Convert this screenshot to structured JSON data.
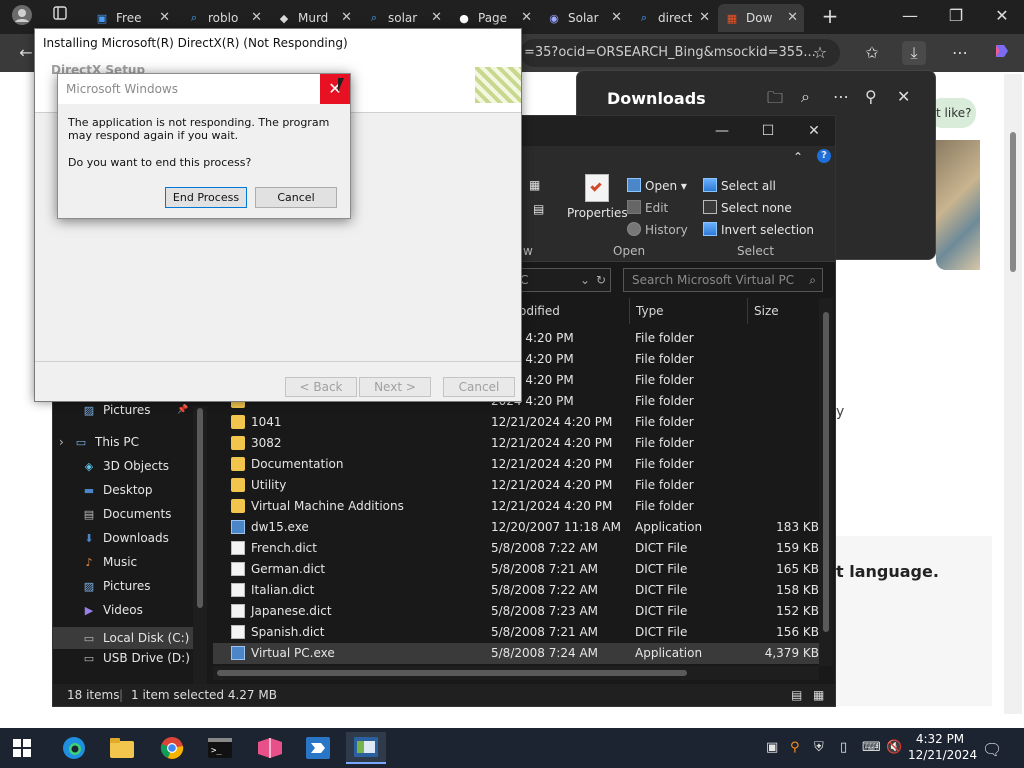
{
  "browser": {
    "tabs": [
      {
        "label": "Free",
        "icon": "edge-page-icon"
      },
      {
        "label": "roblo",
        "icon": "search-icon"
      },
      {
        "label": "Murd",
        "icon": "roblox-icon"
      },
      {
        "label": "solar",
        "icon": "search-icon"
      },
      {
        "label": "Page",
        "icon": "github-icon"
      },
      {
        "label": "Solar",
        "icon": "site-icon"
      },
      {
        "label": "direct",
        "icon": "search-icon"
      },
      {
        "label": "Dow",
        "icon": "microsoft-icon"
      }
    ],
    "address_text": "=35?ocid=ORSEARCH_Bing&msockid=355...",
    "downloads_title": "Downloads"
  },
  "webpage": {
    "bubble_text": "t like?",
    "side_text": "y",
    "language_text": "t language."
  },
  "directx": {
    "title": "Installing Microsoft(R) DirectX(R) (Not Responding)",
    "header": "DirectX Setup",
    "back": "< Back",
    "next": "Next >",
    "cancel": "Cancel"
  },
  "dialog": {
    "title": "Microsoft Windows",
    "message1": "The application is not responding. The program may respond again if you wait.",
    "message2": "Do you want to end this process?",
    "end_process": "End Process",
    "cancel": "Cancel"
  },
  "explorer": {
    "ribbon": {
      "properties": "Properties",
      "open": "Open",
      "edit": "Edit",
      "history": "History",
      "select_all": "Select all",
      "select_none": "Select none",
      "invert_selection": "Invert selection",
      "group_view": "w",
      "group_open": "Open",
      "group_select": "Select"
    },
    "location_fragment": "C",
    "search_placeholder": "Search Microsoft Virtual PC",
    "columns": {
      "modified": "odified",
      "type": "Type",
      "size": "Size"
    },
    "nav": [
      {
        "label": "Pictures",
        "icon": "pictures-icon"
      },
      {
        "label": "This PC",
        "icon": "pc-icon"
      },
      {
        "label": "3D Objects",
        "icon": "3d-objects-icon"
      },
      {
        "label": "Desktop",
        "icon": "desktop-icon"
      },
      {
        "label": "Documents",
        "icon": "documents-icon"
      },
      {
        "label": "Downloads",
        "icon": "downloads-icon"
      },
      {
        "label": "Music",
        "icon": "music-icon"
      },
      {
        "label": "Pictures",
        "icon": "pictures-icon"
      },
      {
        "label": "Videos",
        "icon": "videos-icon"
      },
      {
        "label": "Local Disk (C:)",
        "icon": "drive-icon"
      },
      {
        "label": "USB Drive (D:)",
        "icon": "usb-drive-icon"
      }
    ],
    "files": [
      {
        "name": "",
        "date": "2024 4:20 PM",
        "type": "File folder",
        "size": "",
        "kind": "folder"
      },
      {
        "name": "",
        "date": "2024 4:20 PM",
        "type": "File folder",
        "size": "",
        "kind": "folder"
      },
      {
        "name": "",
        "date": "2024 4:20 PM",
        "type": "File folder",
        "size": "",
        "kind": "folder"
      },
      {
        "name": "",
        "date": "2024 4:20 PM",
        "type": "File folder",
        "size": "",
        "kind": "folder"
      },
      {
        "name": "1041",
        "date": "12/21/2024 4:20 PM",
        "type": "File folder",
        "size": "",
        "kind": "folder"
      },
      {
        "name": "3082",
        "date": "12/21/2024 4:20 PM",
        "type": "File folder",
        "size": "",
        "kind": "folder"
      },
      {
        "name": "Documentation",
        "date": "12/21/2024 4:20 PM",
        "type": "File folder",
        "size": "",
        "kind": "folder"
      },
      {
        "name": "Utility",
        "date": "12/21/2024 4:20 PM",
        "type": "File folder",
        "size": "",
        "kind": "folder"
      },
      {
        "name": "Virtual Machine Additions",
        "date": "12/21/2024 4:20 PM",
        "type": "File folder",
        "size": "",
        "kind": "folder"
      },
      {
        "name": "dw15.exe",
        "date": "12/20/2007 11:18 AM",
        "type": "Application",
        "size": "183 KB",
        "kind": "exe"
      },
      {
        "name": "French.dict",
        "date": "5/8/2008 7:22 AM",
        "type": "DICT File",
        "size": "159 KB",
        "kind": "doc"
      },
      {
        "name": "German.dict",
        "date": "5/8/2008 7:21 AM",
        "type": "DICT File",
        "size": "165 KB",
        "kind": "doc"
      },
      {
        "name": "Italian.dict",
        "date": "5/8/2008 7:22 AM",
        "type": "DICT File",
        "size": "158 KB",
        "kind": "doc"
      },
      {
        "name": "Japanese.dict",
        "date": "5/8/2008 7:23 AM",
        "type": "DICT File",
        "size": "152 KB",
        "kind": "doc"
      },
      {
        "name": "Spanish.dict",
        "date": "5/8/2008 7:21 AM",
        "type": "DICT File",
        "size": "156 KB",
        "kind": "doc"
      },
      {
        "name": "Virtual PC.exe",
        "date": "5/8/2008 7:24 AM",
        "type": "Application",
        "size": "4,379 KB",
        "kind": "exe"
      }
    ],
    "status": {
      "items": "18 items",
      "selected": "1 item selected  4.27 MB"
    }
  },
  "taskbar": {
    "time": "4:32 PM",
    "date": "12/21/2024"
  },
  "colors": {
    "close_red": "#e81123",
    "folder_yellow": "#f2c54c",
    "accent_blue": "#0078d7"
  }
}
